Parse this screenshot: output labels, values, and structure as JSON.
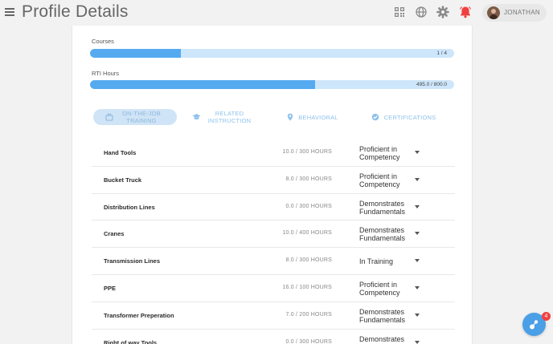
{
  "header": {
    "title": "Profile Details",
    "user_name": "JONATHAN"
  },
  "icons": {
    "menu": "hamburger-menu-icon",
    "qr": "qr-code-icon",
    "globe": "globe-icon",
    "settings": "gear-icon",
    "notifications": "bell-icon",
    "chat": "chat-icon"
  },
  "colors": {
    "accent": "#55aaf0",
    "track": "#cde6fb",
    "bell": "#f04040"
  },
  "progress": {
    "courses": {
      "label": "Courses",
      "text": "1 / 4",
      "fraction": 0.25
    },
    "rti": {
      "label": "RTI Hours",
      "text": "495.0 / 800.0",
      "fraction": 0.619
    }
  },
  "tabs": {
    "ojt": "ON-THE-JOB TRAINING",
    "rti": "RELATED INSTRUCTION",
    "behavioral": "BEHAVIORAL",
    "certifications": "CERTIFICATIONS"
  },
  "rows": [
    {
      "name": "Hand Tools",
      "hours": "10.0 / 300 HOURS",
      "status": "Proficient in Competency"
    },
    {
      "name": "Bucket Truck",
      "hours": "8.0 / 300 HOURS",
      "status": "Proficient in Competency"
    },
    {
      "name": "Distribution Lines",
      "hours": "0.0 / 300 HOURS",
      "status": "Demonstrates Fundamentals"
    },
    {
      "name": "Cranes",
      "hours": "10.0 / 400 HOURS",
      "status": "Demonstrates Fundamentals"
    },
    {
      "name": "Transmission Lines",
      "hours": "8.0 / 300 HOURS",
      "status": "In Training"
    },
    {
      "name": "PPE",
      "hours": "16.0 / 100 HOURS",
      "status": "Proficient in Competency"
    },
    {
      "name": "Transformer Preperation",
      "hours": "7.0 / 200 HOURS",
      "status": "Demonstrates Fundamentals"
    },
    {
      "name": "Right of way Tools",
      "hours": "0.0 / 300 HOURS",
      "status": "Demonstrates Fundamentals"
    }
  ],
  "fab": {
    "badge": "4"
  }
}
